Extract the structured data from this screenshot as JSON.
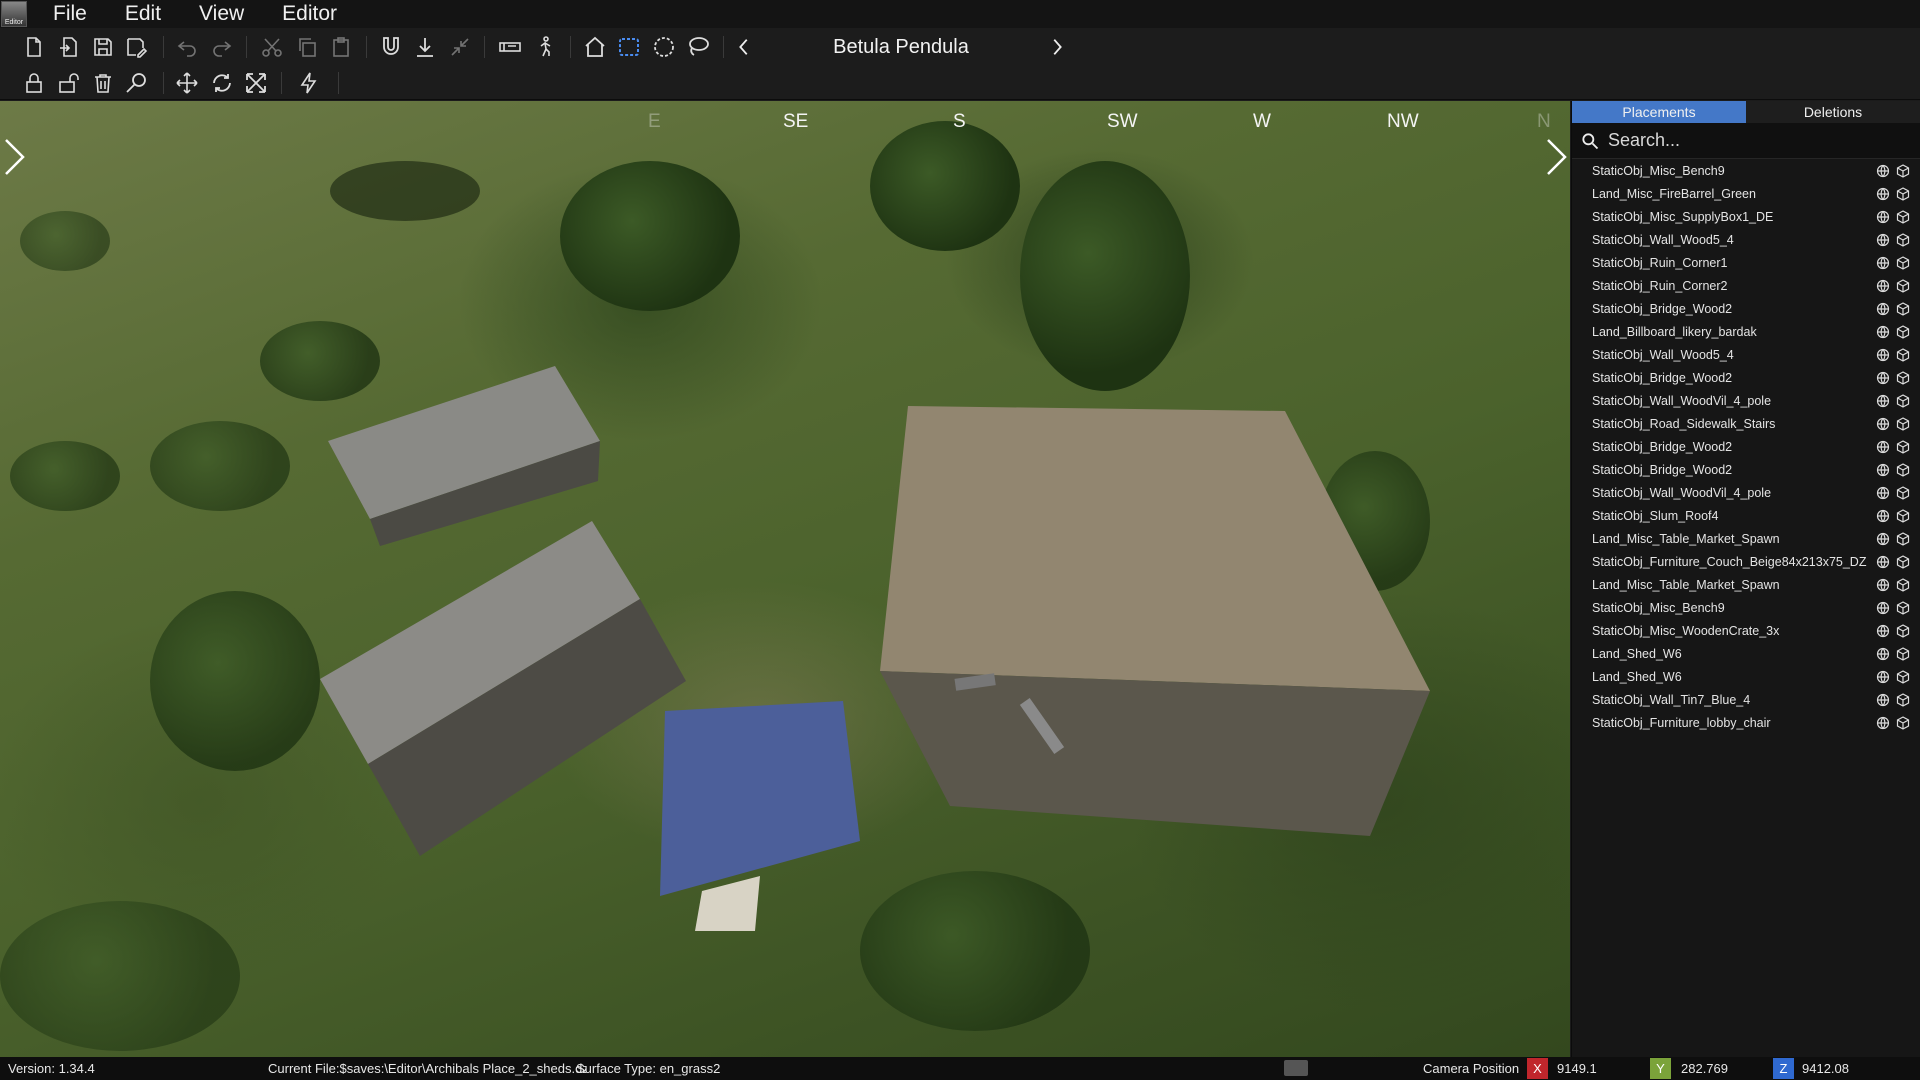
{
  "menu": {
    "items": [
      "File",
      "Edit",
      "View",
      "Editor"
    ],
    "logo_text": "Editor"
  },
  "toolbar": {
    "current_object": "Betula Pendula"
  },
  "viewport": {
    "compass": [
      "E",
      "SE",
      "S",
      "SW",
      "W",
      "NW",
      "N"
    ]
  },
  "panel": {
    "tabs": {
      "placements": "Placements",
      "deletions": "Deletions",
      "active": "Placements"
    },
    "search_placeholder": "Search...",
    "items": [
      "StaticObj_Misc_Bench9",
      "Land_Misc_FireBarrel_Green",
      "StaticObj_Misc_SupplyBox1_DE",
      "StaticObj_Wall_Wood5_4",
      "StaticObj_Ruin_Corner1",
      "StaticObj_Ruin_Corner2",
      "StaticObj_Bridge_Wood2",
      "Land_Billboard_likery_bardak",
      "StaticObj_Wall_Wood5_4",
      "StaticObj_Bridge_Wood2",
      "StaticObj_Wall_WoodVil_4_pole",
      "StaticObj_Road_Sidewalk_Stairs",
      "StaticObj_Bridge_Wood2",
      "StaticObj_Bridge_Wood2",
      "StaticObj_Wall_WoodVil_4_pole",
      "StaticObj_Slum_Roof4",
      "Land_Misc_Table_Market_Spawn",
      "StaticObj_Furniture_Couch_Beige84x213x75_DZ",
      "Land_Misc_Table_Market_Spawn",
      "StaticObj_Misc_Bench9",
      "StaticObj_Misc_WoodenCrate_3x",
      "Land_Shed_W6",
      "Land_Shed_W6",
      "StaticObj_Wall_Tin7_Blue_4",
      "StaticObj_Furniture_lobby_chair"
    ]
  },
  "status": {
    "version": "Version:  1.34.4",
    "current_file": "Current File:$saves:\\Editor\\Archibals Place_2_sheds.dze",
    "surface_type": "Surface Type: en_grass2",
    "camera_label": "Camera Position",
    "x_label": "X",
    "x_value": "9149.1",
    "y_label": "Y",
    "y_value": "282.769",
    "z_label": "Z",
    "z_value": "9412.08",
    "x_color": "#c0262c",
    "y_color": "#7ba33a",
    "z_color": "#2f69d0"
  }
}
